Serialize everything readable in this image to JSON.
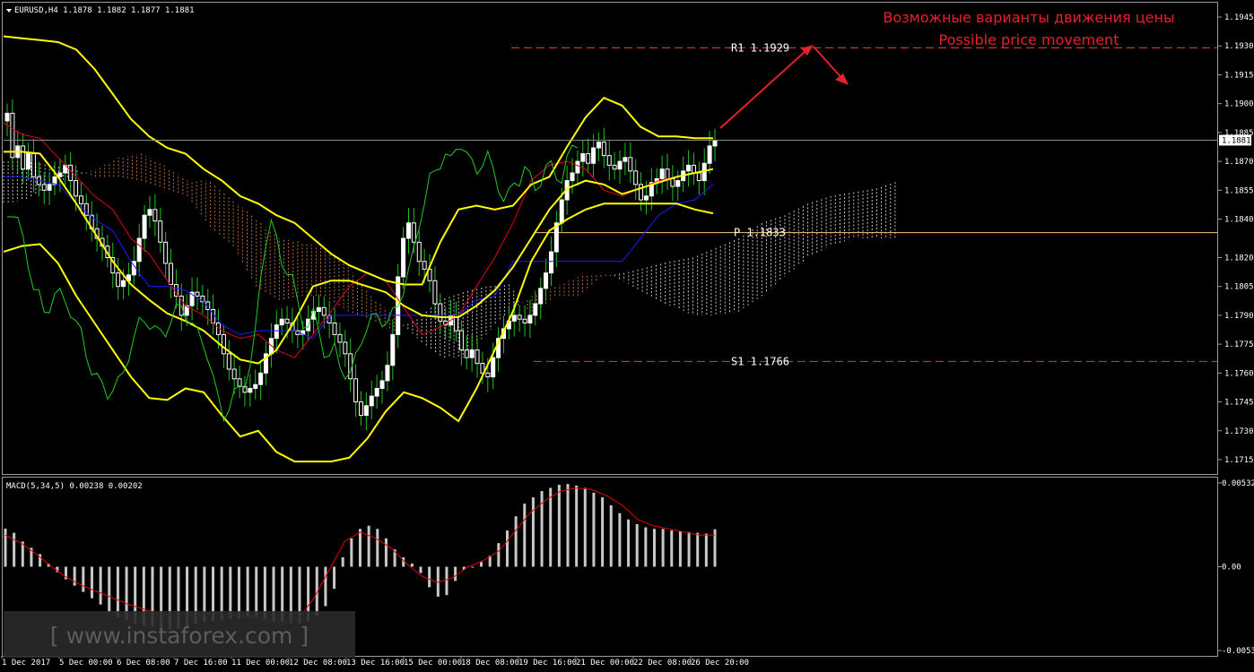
{
  "header": {
    "symbol_line": "EURUSD,H4  1.1878 1.1882 1.1877 1.1881",
    "macd_line": "MACD(5,34,5) 0.00238 0.00202"
  },
  "annotations": {
    "ru": "Возможные варианты движения цены",
    "en": "Possible price movement"
  },
  "levels": {
    "r1": {
      "label": "R1  1.1929",
      "value": 1.1929,
      "color": "#c0392b"
    },
    "pivot": {
      "label": "P  1.1833",
      "value": 1.1833,
      "color": "#d9b36a"
    },
    "s1": {
      "label": "S1  1.1766",
      "value": 1.1766,
      "color": "#c0392b"
    },
    "last": {
      "label": "1.1881",
      "value": 1.1881
    }
  },
  "watermark": "[ www.instaforex.com ]",
  "colors": {
    "bg": "#000000",
    "bull": "#ffffff",
    "bear": "#ffffff",
    "wick": "#1fc21f",
    "bollinger": "#ffff00",
    "tenkan": "#e0001b",
    "kijun": "#1b1bff",
    "chikou": "#22cc22",
    "cloud_up": "#e6e6e6",
    "cloud_down": "#d9824a",
    "arrow": "#e8202a",
    "macd_hist": "#c8c8c8",
    "macd_signal": "#e00000"
  },
  "chart_data": [
    {
      "type": "candlestick",
      "title": "EURUSD,H4",
      "ylim": [
        1.1708,
        1.1952
      ],
      "yticks": [
        "1.1945",
        "1.1930",
        "1.1915",
        "1.1900",
        "1.1885",
        "1.1870",
        "1.1855",
        "1.1840",
        "1.1820",
        "1.1805",
        "1.1790",
        "1.1775",
        "1.1760",
        "1.1745",
        "1.1730",
        "1.1715"
      ],
      "xticks": [
        "1 Dec 2017",
        "5 Dec 00:00",
        "6 Dec 08:00",
        "7 Dec 16:00",
        "11 Dec 00:00",
        "12 Dec 08:00",
        "13 Dec 16:00",
        "15 Dec 00:00",
        "18 Dec 08:00",
        "19 Dec 16:00",
        "21 Dec 00:00",
        "22 Dec 08:00",
        "26 Dec 20:00"
      ],
      "close": [
        1.1895,
        1.1872,
        1.1878,
        1.1866,
        1.1874,
        1.1862,
        1.1858,
        1.1855,
        1.1858,
        1.1862,
        1.1864,
        1.1868,
        1.186,
        1.1852,
        1.1848,
        1.1842,
        1.1835,
        1.183,
        1.1826,
        1.182,
        1.1812,
        1.1805,
        1.1808,
        1.1811,
        1.1818,
        1.183,
        1.1842,
        1.1845,
        1.1839,
        1.1828,
        1.1817,
        1.1806,
        1.18,
        1.179,
        1.1795,
        1.1802,
        1.18,
        1.1797,
        1.1793,
        1.1786,
        1.178,
        1.177,
        1.1762,
        1.1757,
        1.1753,
        1.175,
        1.1752,
        1.1754,
        1.176,
        1.177,
        1.1778,
        1.1785,
        1.1788,
        1.1786,
        1.1782,
        1.178,
        1.1782,
        1.1788,
        1.1792,
        1.1794,
        1.179,
        1.1786,
        1.178,
        1.1776,
        1.177,
        1.1757,
        1.1745,
        1.1738,
        1.1743,
        1.1748,
        1.1752,
        1.1756,
        1.1764,
        1.178,
        1.181,
        1.183,
        1.1838,
        1.1828,
        1.1818,
        1.1814,
        1.1808,
        1.1796,
        1.1787,
        1.1785,
        1.179,
        1.1782,
        1.1772,
        1.1768,
        1.1772,
        1.1765,
        1.176,
        1.1758,
        1.1768,
        1.1778,
        1.1783,
        1.1787,
        1.179,
        1.1788,
        1.1786,
        1.179,
        1.1796,
        1.1804,
        1.1812,
        1.1823,
        1.1838,
        1.185,
        1.186,
        1.1864,
        1.187,
        1.1874,
        1.1869,
        1.1877,
        1.188,
        1.1873,
        1.1868,
        1.1866,
        1.187,
        1.1872,
        1.1865,
        1.1858,
        1.185,
        1.1852,
        1.1859,
        1.1861,
        1.1866,
        1.1861,
        1.1857,
        1.186,
        1.1865,
        1.1868,
        1.1864,
        1.186,
        1.1869,
        1.1878,
        1.1881
      ],
      "bollinger_upper": [
        1.1935,
        1.1934,
        1.1933,
        1.1932,
        1.1928,
        1.1918,
        1.1905,
        1.1892,
        1.1883,
        1.1877,
        1.1874,
        1.1866,
        1.186,
        1.1852,
        1.1848,
        1.1842,
        1.1838,
        1.183,
        1.1822,
        1.1816,
        1.1812,
        1.1808,
        1.1806,
        1.1806,
        1.1828,
        1.1845,
        1.1847,
        1.1845,
        1.1847,
        1.1858,
        1.1862,
        1.1878,
        1.1893,
        1.1903,
        1.1899,
        1.1888,
        1.1883,
        1.1883,
        1.1882,
        1.1882
      ],
      "bollinger_mid": [
        1.1875,
        1.1875,
        1.1874,
        1.1862,
        1.1848,
        1.1833,
        1.1818,
        1.1806,
        1.1798,
        1.1791,
        1.1787,
        1.1782,
        1.1774,
        1.1767,
        1.1765,
        1.1772,
        1.1787,
        1.1805,
        1.1808,
        1.1808,
        1.1805,
        1.1802,
        1.1795,
        1.179,
        1.1789,
        1.1789,
        1.1795,
        1.1803,
        1.1815,
        1.183,
        1.1845,
        1.1856,
        1.186,
        1.1858,
        1.1853,
        1.1856,
        1.1859,
        1.1862,
        1.1864,
        1.1866
      ],
      "bollinger_lower": [
        1.1823,
        1.1826,
        1.1827,
        1.1817,
        1.18,
        1.1786,
        1.1772,
        1.1758,
        1.1747,
        1.1746,
        1.1752,
        1.175,
        1.1738,
        1.1727,
        1.173,
        1.1719,
        1.1714,
        1.1714,
        1.1714,
        1.1716,
        1.1726,
        1.174,
        1.175,
        1.1747,
        1.1742,
        1.1735,
        1.1752,
        1.1772,
        1.1792,
        1.1818,
        1.1834,
        1.184,
        1.1845,
        1.1848,
        1.1848,
        1.1848,
        1.1848,
        1.1848,
        1.1845,
        1.1843
      ],
      "tenkan": [
        1.189,
        1.1884,
        1.1882,
        1.1872,
        1.1862,
        1.1852,
        1.1845,
        1.183,
        1.1822,
        1.1808,
        1.1795,
        1.179,
        1.1782,
        1.1778,
        1.178,
        1.1772,
        1.1768,
        1.178,
        1.1792,
        1.1805,
        1.1812,
        1.1808,
        1.1794,
        1.178,
        1.1784,
        1.179,
        1.1805,
        1.182,
        1.1838,
        1.186,
        1.1868,
        1.187,
        1.1866,
        1.1855,
        1.1852,
        1.1856,
        1.186,
        1.1862,
        1.1864,
        1.1866
      ],
      "kijun": [
        1.1862,
        1.1862,
        1.186,
        1.1858,
        1.1848,
        1.184,
        1.1834,
        1.1818,
        1.1805,
        1.1805,
        1.1803,
        1.1797,
        1.1785,
        1.178,
        1.1782,
        1.1782,
        1.1782,
        1.1778,
        1.179,
        1.179,
        1.179,
        1.179,
        1.179,
        1.179,
        1.179,
        1.179,
        1.1798,
        1.18,
        1.1818,
        1.1818,
        1.1818,
        1.1818,
        1.1818,
        1.1818,
        1.1818,
        1.183,
        1.1842,
        1.1848,
        1.185,
        1.1858
      ],
      "ichimoku_cloud": {
        "span_a": [
          1.187,
          1.187,
          1.1868,
          1.1866,
          1.1862,
          1.1862,
          1.186,
          1.1856,
          1.1852,
          1.1836,
          1.1826,
          1.1805,
          1.1798,
          1.18,
          1.18,
          1.1792,
          1.1788,
          1.1782,
          1.1788,
          1.1798,
          1.1802,
          1.1805,
          1.1806,
          1.179,
          1.18,
          1.18,
          1.181,
          1.1812,
          1.1815,
          1.1818,
          1.182,
          1.1825,
          1.183,
          1.1838,
          1.1842,
          1.1848,
          1.1852,
          1.1854,
          1.1856,
          1.186
        ],
        "span_b": [
          1.1848,
          1.185,
          1.1858,
          1.1862,
          1.1866,
          1.1872,
          1.1874,
          1.1868,
          1.186,
          1.186,
          1.185,
          1.184,
          1.183,
          1.1828,
          1.1825,
          1.1815,
          1.18,
          1.179,
          1.1778,
          1.1768,
          1.1768,
          1.178,
          1.1792,
          1.18,
          1.1805,
          1.181,
          1.1812,
          1.1808,
          1.18,
          1.1795,
          1.179,
          1.179,
          1.1792,
          1.18,
          1.181,
          1.182,
          1.1826,
          1.183,
          1.183,
          1.183
        ]
      }
    },
    {
      "type": "bar",
      "title": "MACD(5,34,5)",
      "ylim": [
        -0.0056,
        0.0056
      ],
      "yticks": [
        "0.00532",
        "0.00",
        "-0.00532"
      ],
      "histogram": [
        0.00242,
        0.00215,
        0.0016,
        0.0012,
        0.0008,
        0.0002,
        -0.00035,
        -0.0008,
        -0.0012,
        -0.0016,
        -0.002,
        -0.0024,
        -0.0029,
        -0.0032,
        -0.0034,
        -0.0036,
        -0.00375,
        -0.0038,
        -0.00395,
        -0.004,
        -0.0039,
        -0.0038,
        -0.0036,
        -0.0035,
        -0.00345,
        -0.0034,
        -0.0033,
        -0.0033,
        -0.0032,
        -0.0032,
        -0.0033,
        -0.00345,
        -0.0035,
        -0.0036,
        -0.0036,
        -0.00345,
        -0.0031,
        -0.0025,
        -0.0014,
        0.0006,
        0.0018,
        0.0024,
        0.0026,
        0.0024,
        0.0018,
        0.0011,
        0.0006,
        0.0002,
        -0.0004,
        -0.0013,
        -0.0019,
        -0.0018,
        -0.0009,
        -0.0002,
        0.0,
        0.0003,
        0.0007,
        0.0015,
        0.0023,
        0.0032,
        0.004,
        0.0044,
        0.0048,
        0.005,
        0.0052,
        0.00525,
        0.00515,
        0.005,
        0.0047,
        0.0044,
        0.0039,
        0.0034,
        0.003,
        0.0027,
        0.0025,
        0.0024,
        0.0024,
        0.0023,
        0.00225,
        0.0022,
        0.00215,
        0.0021,
        0.00238
      ],
      "signal": [
        0.002,
        0.0015,
        0.0008,
        0.0,
        -0.0007,
        -0.0012,
        -0.0016,
        -0.002,
        -0.0024,
        -0.0027,
        -0.003,
        -0.0031,
        -0.0031,
        -0.003,
        -0.003,
        -0.0031,
        -0.0032,
        -0.00345,
        -0.00365,
        -0.0033,
        -0.002,
        -0.0002,
        0.0016,
        0.0022,
        0.0018,
        0.0012,
        0.0002,
        -0.0006,
        -0.001,
        -0.0007,
        0.0,
        0.0004,
        0.001,
        0.0022,
        0.0034,
        0.0042,
        0.0048,
        0.005,
        0.0049,
        0.0045,
        0.0039,
        0.003,
        0.0026,
        0.0024,
        0.0022,
        0.002,
        0.00202
      ]
    }
  ]
}
